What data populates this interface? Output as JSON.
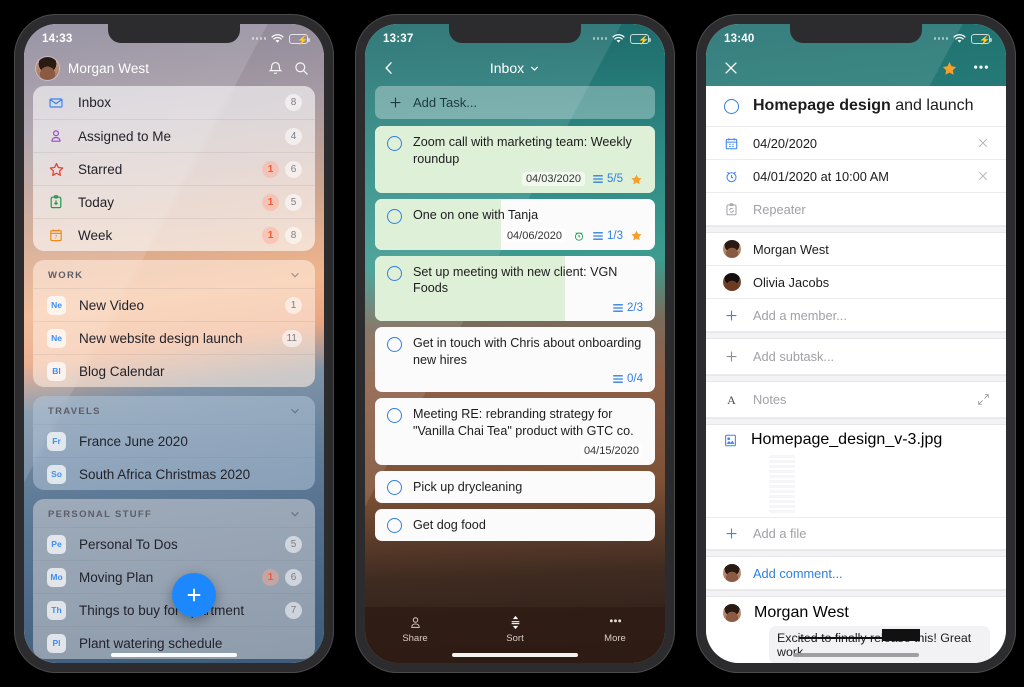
{
  "phone1": {
    "status": {
      "time": "14:33"
    },
    "header": {
      "user": "Morgan West",
      "bell": "bell-icon",
      "search": "search-icon"
    },
    "smart_lists": [
      {
        "icon": "envelope-icon",
        "label": "Inbox",
        "overdue": "",
        "count": "8"
      },
      {
        "icon": "person-icon",
        "label": "Assigned to Me",
        "overdue": "",
        "count": "4"
      },
      {
        "icon": "star-icon",
        "label": "Starred",
        "overdue": "1",
        "count": "6"
      },
      {
        "icon": "clipboard-down-icon",
        "label": "Today",
        "overdue": "1",
        "count": "5"
      },
      {
        "icon": "calendar-7-icon",
        "label": "Week",
        "overdue": "1",
        "count": "8"
      }
    ],
    "groups": [
      {
        "title": "WORK",
        "items": [
          {
            "abbr": "Ne",
            "label": "New Video",
            "overdue": "",
            "count": "1"
          },
          {
            "abbr": "Ne",
            "label": "New website design launch",
            "overdue": "",
            "count": "11"
          },
          {
            "abbr": "Bl",
            "label": "Blog Calendar",
            "overdue": "",
            "count": ""
          }
        ]
      },
      {
        "title": "TRAVELS",
        "items": [
          {
            "abbr": "Fr",
            "label": "France June 2020",
            "overdue": "",
            "count": ""
          },
          {
            "abbr": "So",
            "label": "South Africa Christmas 2020",
            "overdue": "",
            "count": ""
          }
        ]
      },
      {
        "title": "PERSONAL STUFF",
        "items": [
          {
            "abbr": "Pe",
            "label": "Personal To Dos",
            "overdue": "",
            "count": "5"
          },
          {
            "abbr": "Mo",
            "label": "Moving Plan",
            "overdue": "1",
            "count": "6"
          },
          {
            "abbr": "Th",
            "label": "Things to buy for apartment",
            "overdue": "",
            "count": "7"
          },
          {
            "abbr": "Pl",
            "label": "Plant watering schedule",
            "overdue": "",
            "count": ""
          }
        ]
      }
    ],
    "fab": "+"
  },
  "phone2": {
    "status": {
      "time": "13:37"
    },
    "header": {
      "back": "chevron-left-icon",
      "title": "Inbox",
      "caret": "chevron-down-icon"
    },
    "add_task": {
      "label": "Add Task...",
      "icon": "plus-icon"
    },
    "tasks": [
      {
        "text": "Zoom call with marketing team: Weekly roundup",
        "date": "04/03/2020",
        "reminder": false,
        "subtasks": "5/5",
        "starred": true,
        "progress": 100
      },
      {
        "text": "One on one with Tanja",
        "date": "04/06/2020",
        "reminder": true,
        "subtasks": "1/3",
        "starred": true,
        "progress": 45
      },
      {
        "text": "Set up meeting with new client: VGN Foods",
        "date": "",
        "reminder": false,
        "subtasks": "2/3",
        "starred": false,
        "progress": 68
      },
      {
        "text": "Get in touch with Chris about onboarding new hires",
        "date": "",
        "reminder": false,
        "subtasks": "0/4",
        "starred": false,
        "progress": 0
      },
      {
        "text": "Meeting RE: rebranding strategy for \"Vanilla Chai Tea\" product with GTC co.",
        "date": "04/15/2020",
        "reminder": false,
        "subtasks": "",
        "starred": false,
        "progress": 0
      },
      {
        "text": "Pick up drycleaning",
        "date": "",
        "reminder": false,
        "subtasks": "",
        "starred": false,
        "progress": 0
      },
      {
        "text": "Get dog food",
        "date": "",
        "reminder": false,
        "subtasks": "",
        "starred": false,
        "progress": 0
      }
    ],
    "tabbar": [
      {
        "icon": "person-icon",
        "label": "Share"
      },
      {
        "icon": "sort-icon",
        "label": "Sort"
      },
      {
        "icon": "ellipsis-icon",
        "label": "More"
      }
    ]
  },
  "phone3": {
    "status": {
      "time": "13:40"
    },
    "header": {
      "close": "close-icon",
      "star": "star-filled-icon",
      "more": "ellipsis-icon"
    },
    "task_title_bold": "Homepage design",
    "task_title_rest": " and launch",
    "due_date": "04/20/2020",
    "reminder": "04/01/2020 at 10:00 AM",
    "repeater_placeholder": "Repeater",
    "members": [
      {
        "name": "Morgan West",
        "avatar": "morgan"
      },
      {
        "name": "Olivia Jacobs",
        "avatar": "olivia"
      }
    ],
    "add_member": "Add a member...",
    "add_subtask": "Add subtask...",
    "notes": "Notes",
    "attachment": "Homepage_design_v-3.jpg",
    "add_file": "Add a file",
    "add_comment": "Add comment...",
    "comment": {
      "author": "Morgan West",
      "text": "Excited to finally release this! Great work"
    }
  },
  "colors": {
    "accent_blue": "#2f7fe0",
    "fab_blue": "#1d88fd",
    "star_orange": "#f5a02a",
    "teal_header": "#2f8f88",
    "badge_red": "#ef5a36",
    "battery_green": "#4cd964"
  }
}
